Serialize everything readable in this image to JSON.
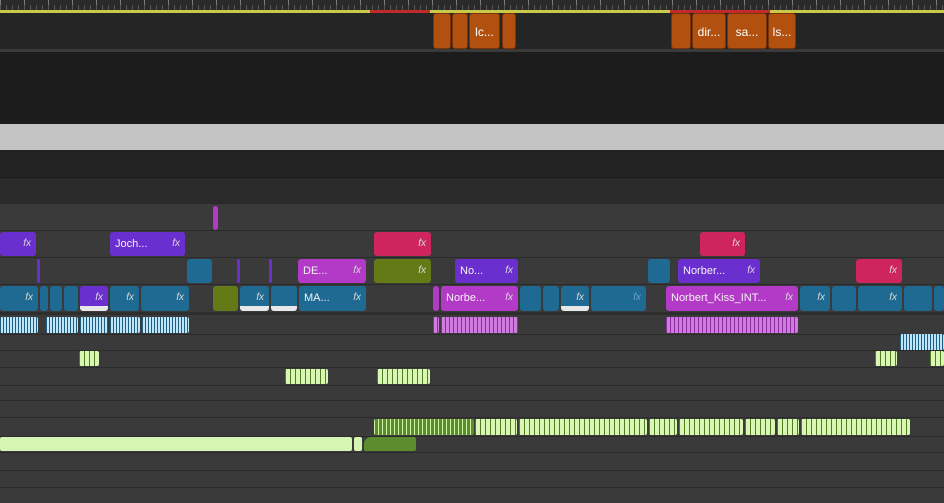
{
  "timeline": {
    "caption_clips": [
      {
        "label": ""
      },
      {
        "label": ""
      },
      {
        "label": "lc..."
      },
      {
        "label": ""
      },
      {
        "label": ""
      },
      {
        "label": "dir..."
      },
      {
        "label": "sa..."
      },
      {
        "label": "ls..."
      }
    ],
    "fx_badge": "fx",
    "video_clips": {
      "track4": [
        {
          "label": ""
        },
        {
          "label": "Joch..."
        },
        {
          "label": ""
        },
        {
          "label": ""
        }
      ],
      "track3": [
        {
          "label": ""
        },
        {
          "label": ""
        },
        {
          "label": ""
        },
        {
          "label": ""
        },
        {
          "label": "DE..."
        },
        {
          "label": ""
        },
        {
          "label": "No..."
        },
        {
          "label": ""
        },
        {
          "label": "Norber..."
        },
        {
          "label": ""
        }
      ],
      "track2": [
        {
          "label": ""
        },
        {
          "label": ""
        },
        {
          "label": ""
        },
        {
          "label": ""
        },
        {
          "label": ""
        },
        {
          "label": ""
        },
        {
          "label": "MA..."
        },
        {
          "label": "Norbe..."
        },
        {
          "label": ""
        },
        {
          "label": "Norbert_Kiss_INT..."
        },
        {
          "label": ""
        }
      ]
    }
  }
}
